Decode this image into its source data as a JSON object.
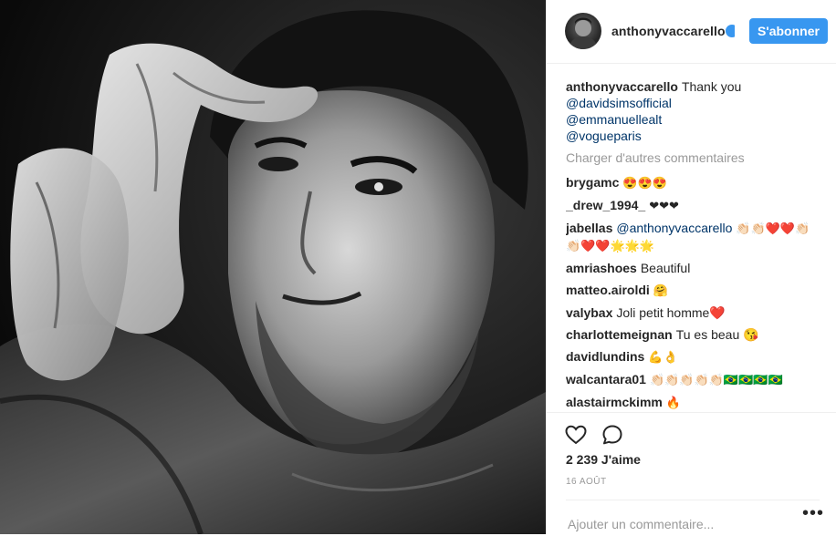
{
  "post": {
    "username": "anthonyvaccarello",
    "follow_label": "S'abonner",
    "caption": {
      "user": "anthonyvaccarello",
      "text": "Thank you",
      "mentions": [
        "@davidsimsofficial",
        "@emmanuellealt",
        "@vogueparis"
      ]
    },
    "load_more": "Charger d'autres commentaires",
    "comments": [
      {
        "user": "brygamc",
        "text": "😍😍😍"
      },
      {
        "user": "_drew_1994_",
        "text": "❤❤❤"
      },
      {
        "user": "jabellas",
        "mention": "@anthonyvaccarello",
        "text": "👏🏻👏🏻❤️❤️👏🏻👏🏻❤️❤️🌟🌟🌟"
      },
      {
        "user": "amriashoes",
        "text": "Beautiful"
      },
      {
        "user": "matteo.airoldi",
        "text": "🤗"
      },
      {
        "user": "valybax",
        "text": "Joli petit homme❤️"
      },
      {
        "user": "charlottemeignan",
        "text": "Tu es beau 😘"
      },
      {
        "user": "davidlundins",
        "text": "💪👌"
      },
      {
        "user": "walcantara01",
        "text": "👏🏻👏🏻👏🏻👏🏻👏🏻🇧🇷🇧🇷🇧🇷🇧🇷"
      },
      {
        "user": "alastairmckimm",
        "text": "🔥"
      }
    ],
    "likes": "2 239 J'aime",
    "date": "16 AOÛT",
    "add_comment_placeholder": "Ajouter un commentaire...",
    "more_options": "•••"
  },
  "icons": {
    "like": "heart-outline-icon",
    "comment": "comment-bubble-icon",
    "verified": "verified-badge-icon"
  },
  "colors": {
    "accent": "#3897f0",
    "link": "#003569",
    "muted": "#999999"
  }
}
